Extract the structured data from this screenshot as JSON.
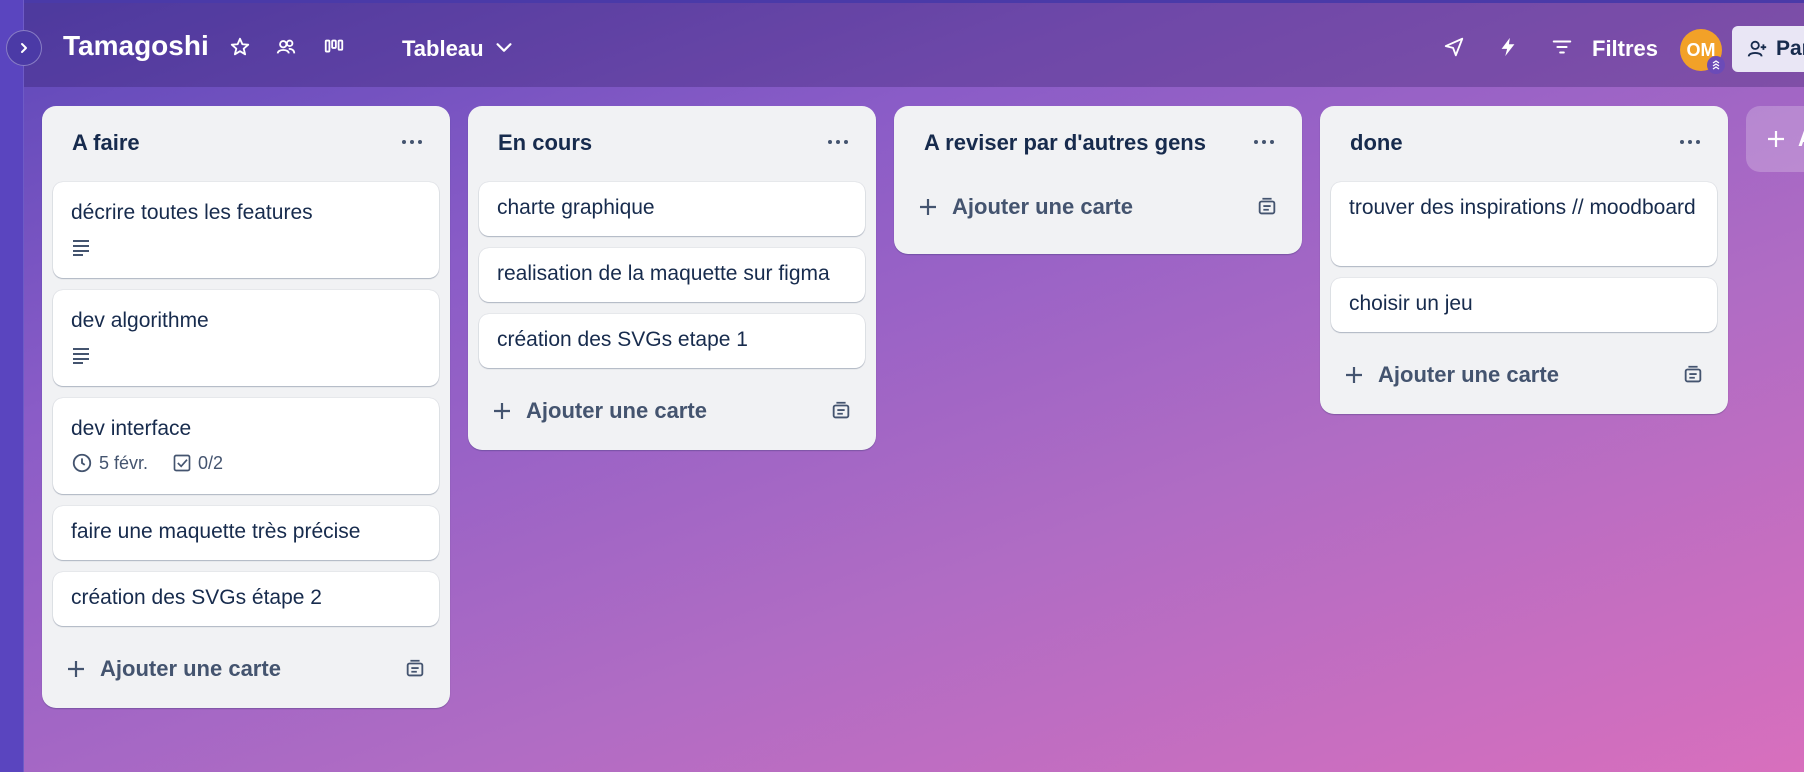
{
  "header": {
    "board_title": "Tamagoshi",
    "view_label": "Tableau",
    "filters_label": "Filtres",
    "avatar_initials": "OM",
    "share_label": "Partag"
  },
  "lists": [
    {
      "title": "A faire",
      "cards": [
        {
          "title": "décrire toutes les features",
          "has_description": true
        },
        {
          "title": "dev algorithme",
          "has_description": true
        },
        {
          "title": "dev interface",
          "due": "5 févr.",
          "checklist": "0/2"
        },
        {
          "title": "faire une maquette très précise"
        },
        {
          "title": "création des SVGs étape 2"
        }
      ],
      "add_label": "Ajouter une carte"
    },
    {
      "title": "En cours",
      "cards": [
        {
          "title": "charte graphique"
        },
        {
          "title": "realisation de la maquette sur figma"
        },
        {
          "title": "création des SVGs etape 1"
        }
      ],
      "add_label": "Ajouter une carte"
    },
    {
      "title": "A reviser par d'autres gens",
      "cards": [],
      "add_label": "Ajouter une carte"
    },
    {
      "title": "done",
      "cards": [
        {
          "title": "trouver des inspirations // moodboard"
        },
        {
          "title": "choisir un jeu"
        }
      ],
      "add_label": "Ajouter une carte"
    }
  ],
  "add_list_label": "A",
  "colors": {
    "accent": "#5a45bf",
    "avatar": "#f2a128",
    "list_bg": "#f1f2f4",
    "text": "#172b4d"
  }
}
